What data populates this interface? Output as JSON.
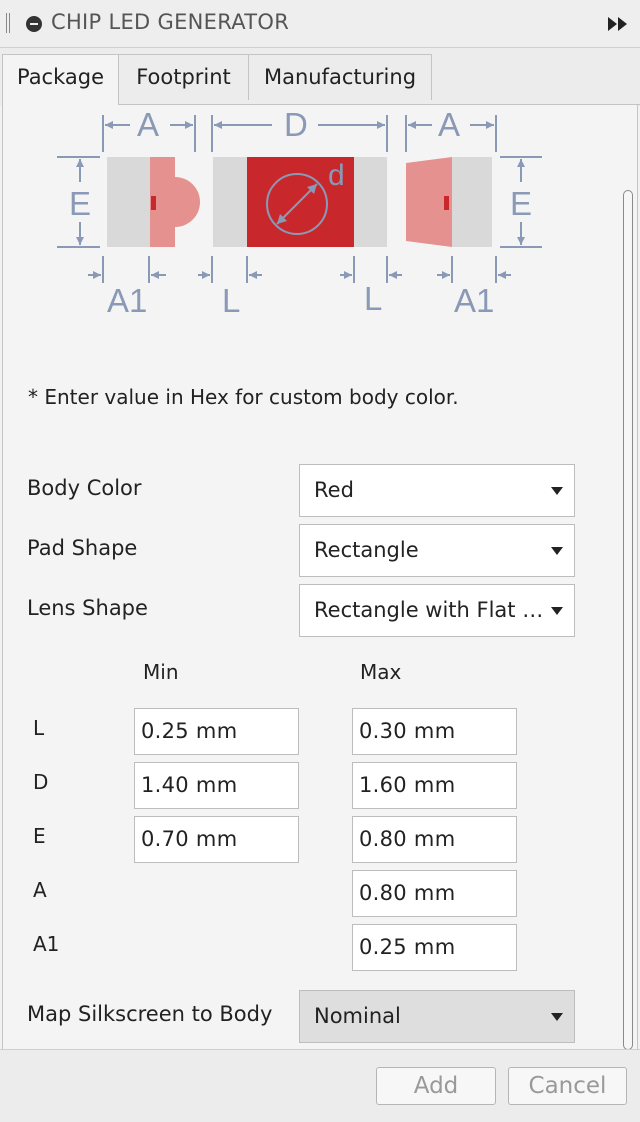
{
  "window": {
    "title": "CHIP LED GENERATOR"
  },
  "tabs": [
    {
      "label": "Package",
      "active": true
    },
    {
      "label": "Footprint",
      "active": false
    },
    {
      "label": "Manufacturing",
      "active": false
    }
  ],
  "diagram": {
    "labels": {
      "A": "A",
      "D": "D",
      "E": "E",
      "d": "d",
      "A1": "A1",
      "L": "L"
    },
    "colors": {
      "dim": "#8a9ab6",
      "body": "#d9d9d9",
      "lens": "#e59190",
      "chip": "#c8282c",
      "pad": "#d9d9d9"
    }
  },
  "note": "* Enter value in Hex for custom body color.",
  "fields": {
    "body_color": {
      "label": "Body Color",
      "value": "Red"
    },
    "pad_shape": {
      "label": "Pad Shape",
      "value": "Rectangle"
    },
    "lens_shape": {
      "label": "Lens Shape",
      "value": "Rectangle with Flat T..."
    },
    "map_silkscreen": {
      "label": "Map Silkscreen to Body",
      "value": "Nominal"
    }
  },
  "dimensions": {
    "min_header": "Min",
    "max_header": "Max",
    "rows": [
      {
        "name": "L",
        "min": "0.25 mm",
        "max": "0.30 mm"
      },
      {
        "name": "D",
        "min": "1.40 mm",
        "max": "1.60 mm"
      },
      {
        "name": "E",
        "min": "0.70 mm",
        "max": "0.80 mm"
      },
      {
        "name": "A",
        "min": null,
        "max": "0.80 mm"
      },
      {
        "name": "A1",
        "min": null,
        "max": "0.25 mm"
      }
    ]
  },
  "buttons": {
    "add": "Add",
    "cancel": "Cancel"
  }
}
